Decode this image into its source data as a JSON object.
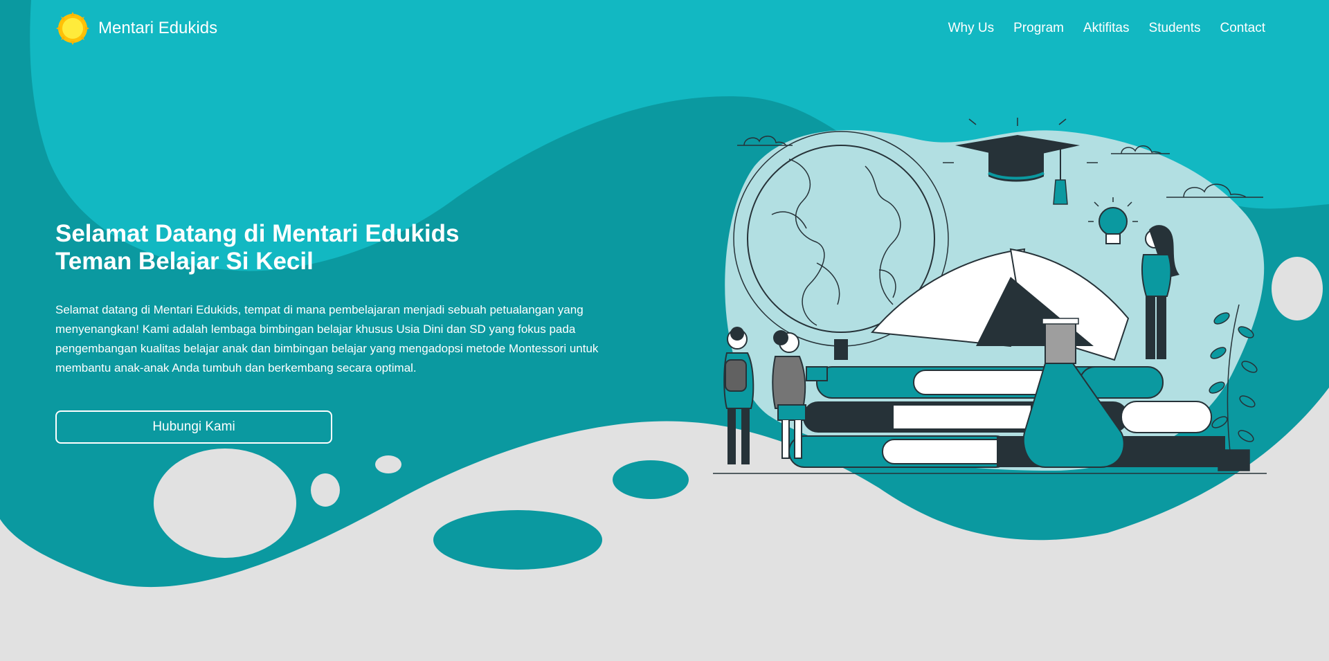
{
  "brand": {
    "name": "Mentari Edukids",
    "logo_icon": "sun-icon"
  },
  "nav": {
    "items": [
      "Why Us",
      "Program",
      "Aktifitas",
      "Students",
      "Contact"
    ]
  },
  "hero": {
    "title_line1": "Selamat Datang di Mentari Edukids",
    "title_line2": "Teman Belajar Si Kecil",
    "description": "Selamat datang di Mentari Edukids, tempat di mana pembelajaran menjadi sebuah petualangan yang menyenangkan! Kami adalah lembaga bimbingan belajar khusus Usia Dini dan SD yang fokus pada pengembangan kualitas belajar anak dan bimbingan belajar yang mengadopsi metode Montessori untuk membantu anak-anak Anda tumbuh dan berkembang secara optimal.",
    "cta_label": "Hubungi Kami"
  },
  "illustration": {
    "icons": [
      "globe-icon",
      "graduation-cap-icon",
      "lightbulb-icon",
      "books-icon",
      "flask-icon",
      "plant-icon",
      "cloud-icon"
    ]
  },
  "colors": {
    "primary_teal": "#0b99a0",
    "light_teal": "#12b8c2",
    "pale_teal": "#b2dfe2",
    "background_gray": "#e1e1e1",
    "dark": "#263238",
    "sun": "#ffc107"
  }
}
